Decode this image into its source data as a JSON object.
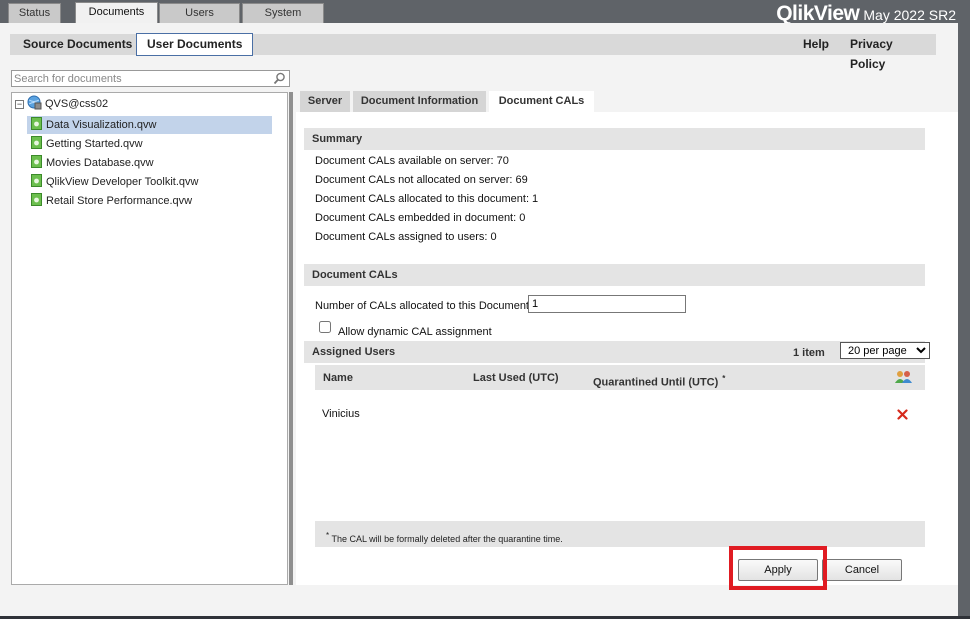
{
  "top_tabs": [
    {
      "label": "Status",
      "active": false
    },
    {
      "label": "Documents",
      "active": true
    },
    {
      "label": "Users",
      "active": false
    },
    {
      "label": "System",
      "active": false
    }
  ],
  "brand": {
    "logo_text": "QlikView",
    "version": "May 2022 SR2"
  },
  "subnav": {
    "left": [
      {
        "label": "Source Documents"
      },
      {
        "label": "User Documents",
        "active": true
      }
    ],
    "right": [
      {
        "label": "Help"
      },
      {
        "label": "Privacy Policy"
      }
    ]
  },
  "search": {
    "placeholder": "Search for documents",
    "value": ""
  },
  "tree": {
    "root": "QVS@css02",
    "items": [
      {
        "label": "Data Visualization.qvw",
        "selected": true
      },
      {
        "label": "Getting Started.qvw"
      },
      {
        "label": "Movies Database.qvw"
      },
      {
        "label": "QlikView Developer Toolkit.qvw"
      },
      {
        "label": "Retail Store Performance.qvw"
      }
    ]
  },
  "detail_tabs": [
    {
      "label": "Server"
    },
    {
      "label": "Document Information"
    },
    {
      "label": "Document CALs",
      "active": true
    }
  ],
  "summary": {
    "title": "Summary",
    "lines": [
      "Document CALs available on server: 70",
      "Document CALs not allocated on server: 69",
      "Document CALs allocated to this document: 1",
      "Document CALs embedded in document: 0",
      "Document CALs assigned to users: 0"
    ]
  },
  "document_cals": {
    "title": "Document CALs",
    "allocated_label": "Number of CALs allocated to this Document:",
    "allocated_value": "1",
    "dynamic_label": "Allow dynamic CAL assignment",
    "dynamic_checked": false
  },
  "assigned_users": {
    "title": "Assigned Users",
    "count": "1 item",
    "per_page": "20 per page",
    "per_page_options": [
      "20 per page"
    ],
    "columns": {
      "name": "Name",
      "last_used": "Last Used (UTC)",
      "quarantined": "Quarantined Until (UTC)",
      "asterisk": "*"
    },
    "rows": [
      {
        "name": "Vinicius"
      }
    ],
    "footnote_asterisk": "*",
    "footnote": "The CAL will be formally deleted after the quarantine time."
  },
  "buttons": {
    "apply": "Apply",
    "cancel": "Cancel"
  },
  "colors": {
    "highlight": "#e01b22",
    "selected_row": "#c2d3ea",
    "delete": "#d6291b"
  },
  "icons": {
    "search": "magnifier-icon",
    "server": "globe-server-icon",
    "document": "qlikview-document-icon",
    "add_users": "users-group-icon",
    "delete": "red-x-icon"
  }
}
